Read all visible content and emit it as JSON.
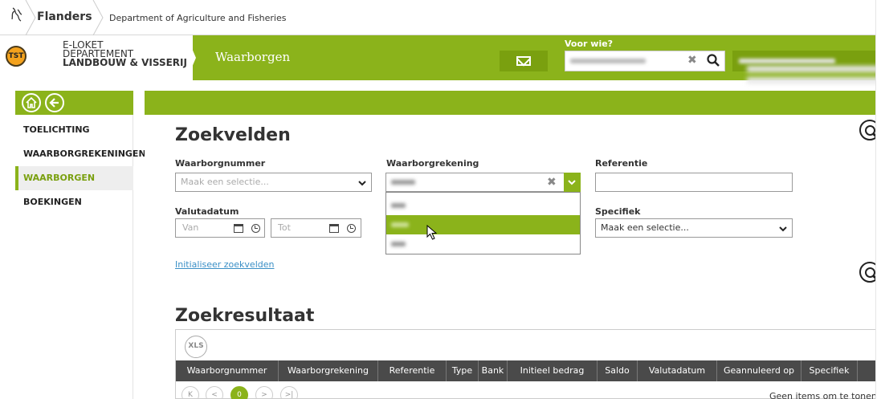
{
  "topbar": {
    "flanders": "Flanders",
    "department": "Department of Agriculture and Fisheries"
  },
  "header": {
    "badge": "TST",
    "eloket_line1": "E-LOKET",
    "eloket_line2": "DEPARTEMENT",
    "eloket_line3": "LANDBOUW & VISSERIJ",
    "app_title": "Waarborgen",
    "voor_wie_label": "Voor wie?"
  },
  "sidebar": {
    "items": [
      {
        "label": "TOELICHTING",
        "active": false
      },
      {
        "label": "WAARBORGREKENINGEN",
        "active": false
      },
      {
        "label": "WAARBORGEN",
        "active": true
      },
      {
        "label": "BOEKINGEN",
        "active": false
      }
    ]
  },
  "search": {
    "title": "Zoekvelden",
    "waarborgnummer_label": "Waarborgnummer",
    "waarborgnummer_placeholder": "Maak een selectie...",
    "waarborgrekening_label": "Waarborgrekening",
    "referentie_label": "Referentie",
    "valutadatum_label": "Valutadatum",
    "van_placeholder": "Van",
    "tot_placeholder": "Tot",
    "specifiek_label": "Specifiek",
    "specifiek_value": "Maak een selectie...",
    "reset_link": "Initialiseer zoekvelden"
  },
  "results": {
    "title": "Zoekresultaat",
    "xls_label": "XLS",
    "columns": [
      "Waarborgnummer",
      "Waarborgrekening",
      "Referentie",
      "Type",
      "Bank",
      "Initieel bedrag",
      "Saldo",
      "Valutadatum",
      "Geannuleerd op",
      "Specifiek"
    ],
    "pager": {
      "first": "K",
      "prev": "<",
      "current": "0",
      "next": ">",
      "last": ">|"
    },
    "empty_text": "Geen items om te tonen"
  },
  "colors": {
    "green": "#8bb31b",
    "dark_green": "#7aa00f",
    "header_dark": "#4a4a4a",
    "link": "#3a8fc6",
    "badge": "#f4a21d"
  }
}
